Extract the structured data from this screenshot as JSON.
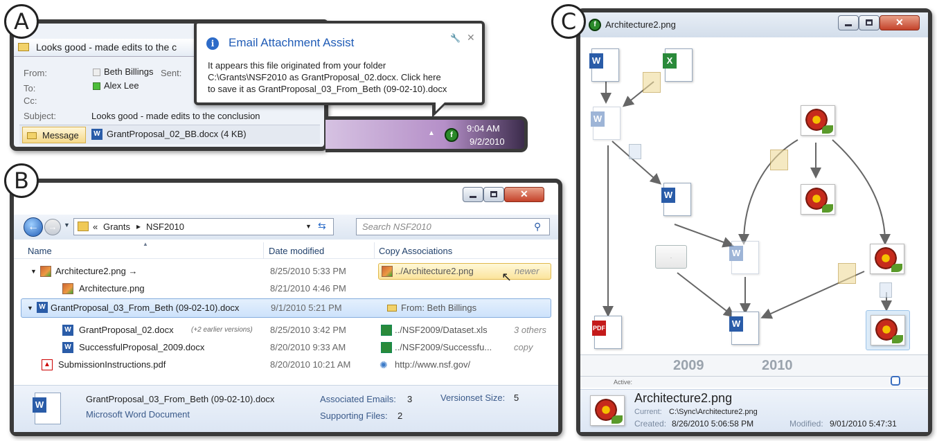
{
  "labels": {
    "a": "A",
    "b": "B",
    "c": "C"
  },
  "panel_a": {
    "email_title": "Looks good - made edits to the c",
    "from_label": "From:",
    "from_value": "Beth Billings",
    "sent_label": "Sent:",
    "to_label": "To:",
    "to_value": "Alex Lee",
    "cc_label": "Cc:",
    "subject_label": "Subject:",
    "subject_value": "Looks good - made edits to the conclusion",
    "message_tab": "Message",
    "attachment": "GrantProposal_02_BB.docx (4 KB)",
    "balloon": {
      "title": "Email Attachment Assist",
      "text_1": "It appears this file originated from your folder",
      "text_2": "C:\\Grants\\NSF2010 as GrantProposal_02.docx. Click here",
      "text_3": "to save it as GrantProposal_03_From_Beth (09-02-10).docx"
    },
    "clock_time": "9:04 AM",
    "clock_date": "9/2/2010"
  },
  "panel_b": {
    "breadcrumb": [
      "«",
      "Grants",
      "▸",
      "NSF2010"
    ],
    "search_placeholder": "Search NSF2010",
    "columns": {
      "name": "Name",
      "date": "Date modified",
      "assoc": "Copy Associations"
    },
    "rows": [
      {
        "name": "Architecture2.png →",
        "date": "8/25/2010 5:33 PM",
        "assoc": "../Architecture2.png",
        "note": "newer"
      },
      {
        "name": "Architecture.png",
        "date": "8/21/2010 4:46 PM",
        "assoc": "",
        "note": ""
      },
      {
        "name": "GrantProposal_03_From_Beth (09-02-10).docx",
        "date": "9/1/2010 5:21 PM",
        "assoc": "From: Beth Billings",
        "note": ""
      },
      {
        "name": "GrantProposal_02.docx",
        "sub": "(+2 earlier versions)",
        "date": "8/25/2010 3:42 PM",
        "assoc": "../NSF2009/Dataset.xls",
        "note": "3 others"
      },
      {
        "name": "SuccessfulProposal_2009.docx",
        "date": "8/20/2010 9:33 AM",
        "assoc": "../NSF2009/Successfu...",
        "note": "copy"
      },
      {
        "name": "SubmissionInstructions.pdf",
        "date": "8/20/2010 10:21 AM",
        "assoc": "http://www.nsf.gov/",
        "note": ""
      }
    ],
    "details": {
      "filename": "GrantProposal_03_From_Beth (09-02-10).docx",
      "filetype": "Microsoft Word Document",
      "assoc_emails_label": "Associated Emails:",
      "assoc_emails_value": "3",
      "versionset_label": "Versionset Size:",
      "versionset_value": "5",
      "supporting_label": "Supporting Files:",
      "supporting_value": "2"
    }
  },
  "panel_c": {
    "title": "Architecture2.png",
    "years": [
      "2009",
      "2010"
    ],
    "active_label": "Active:",
    "details": {
      "filename": "Architecture2.png",
      "current_label": "Current:",
      "current_value": "C:\\Sync\\Architecture2.png",
      "created_label": "Created:",
      "created_value": "8/26/2010 5:06:58 PM",
      "modified_label": "Modified:",
      "modified_value": "9/01/2010 5:47:31"
    }
  }
}
